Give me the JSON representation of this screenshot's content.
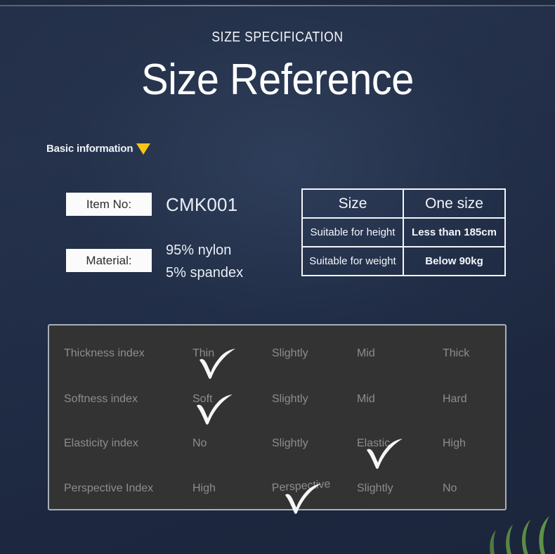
{
  "header": {
    "kicker": "SIZE SPECIFICATION",
    "title": "Size Reference"
  },
  "section": {
    "heading": "Basic information",
    "marker_icon": "triangle-down-icon",
    "marker_color": "#f5c518"
  },
  "basic_info": {
    "item_no_label": "Item No:",
    "item_no_value": "CMK001",
    "material_label": "Material:",
    "material_line1": "95% nylon",
    "material_line2": "5% spandex"
  },
  "size_table": {
    "rows": [
      {
        "label": "Size",
        "value": "One size"
      },
      {
        "label": "Suitable for height",
        "value": "Less than 185cm"
      },
      {
        "label": "Suitable for weight",
        "value": "Below 90kg"
      }
    ]
  },
  "index_panel": {
    "rows": [
      {
        "label": "Thickness index",
        "options": [
          "Thin",
          "Slightly",
          "Mid",
          "Thick"
        ],
        "selected_index": 0
      },
      {
        "label": "Softness index",
        "options": [
          "Soft",
          "Slightly",
          "Mid",
          "Hard"
        ],
        "selected_index": 0
      },
      {
        "label": "Elasticity index",
        "options": [
          "No",
          "Slightly",
          "Elastic",
          "High"
        ],
        "selected_index": 2
      },
      {
        "label": "Perspective Index",
        "options": [
          "High",
          "Perspective",
          "Slightly",
          "No"
        ],
        "selected_index": 1
      }
    ],
    "check_icon": "checkmark-icon",
    "background": "#333333",
    "border_color": "#a7b0bb"
  },
  "decor": {
    "grass_icon": "grass-blades-icon",
    "grass_color": "#4d7a3a"
  },
  "theme": {
    "background": "#1e2a42",
    "text_primary": "#f2f5fa",
    "text_muted": "#8d8d8d",
    "accent": "#f5c518"
  }
}
